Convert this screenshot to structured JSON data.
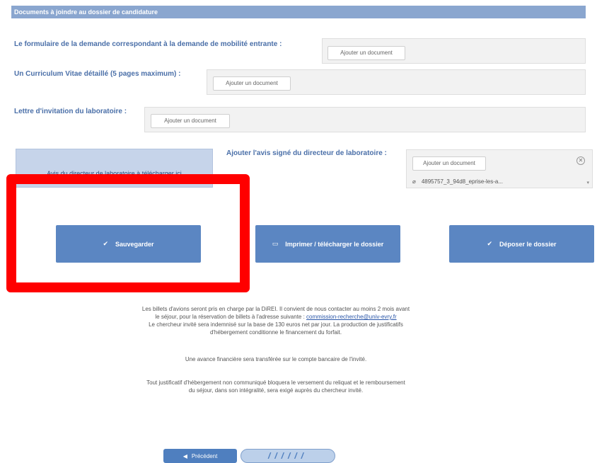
{
  "section": {
    "title": "Documents à joindre au dossier de candidature"
  },
  "fields": {
    "formulaire": {
      "label": "Le formulaire de la demande correspondant à la demande de mobilité entrante :",
      "button": "Ajouter un document"
    },
    "cv": {
      "label": "Un Curriculum Vitae détaillé (5 pages maximum) :",
      "button": "Ajouter un document"
    },
    "lettre": {
      "label": "Lettre d'invitation du laboratoire :",
      "button": "Ajouter un document"
    },
    "avis": {
      "box_label": "Avis du directeur de laboratoire à télécharger ici",
      "label": "Ajouter l'avis signé du directeur de laboratoire :",
      "button": "Ajouter un document",
      "file_name": "4895757_3_94d8_eprise-les-a..."
    }
  },
  "actions": {
    "save": "Sauvegarder",
    "print": "Imprimer / télécharger le dossier",
    "submit": "Déposer le dossier"
  },
  "info": {
    "p1_line1": "Les billets d'avions seront pris en charge par la DiREI. Il convient de nous contacter au moins 2 mois avant",
    "p1_line2": "le séjour, pour la réservation de billets à l'adresse suivante :",
    "p1_email": "commission-recherche@univ-evry.fr",
    "p2_line1": "Le chercheur invité sera indemnisé sur la base de 130 euros net par jour. La production de justificatifs",
    "p2_line2": "d'hébergement conditionne le financement du forfait.",
    "p3": "Une avance financière sera transférée sur le compte bancaire de l'invité.",
    "p4_line1": "Tout justificatif d'hébergement non communiqué bloquera le versement du reliquat et le remboursement",
    "p4_line2": "du séjour, dans son intégralité, sera exigé auprès du chercheur invité."
  },
  "nav": {
    "previous": "Précédent",
    "next": "//////"
  },
  "colors": {
    "header": "#8aa6cf",
    "button": "#5b86c2",
    "label": "#4a6fa8",
    "highlight": "#ff0000"
  }
}
